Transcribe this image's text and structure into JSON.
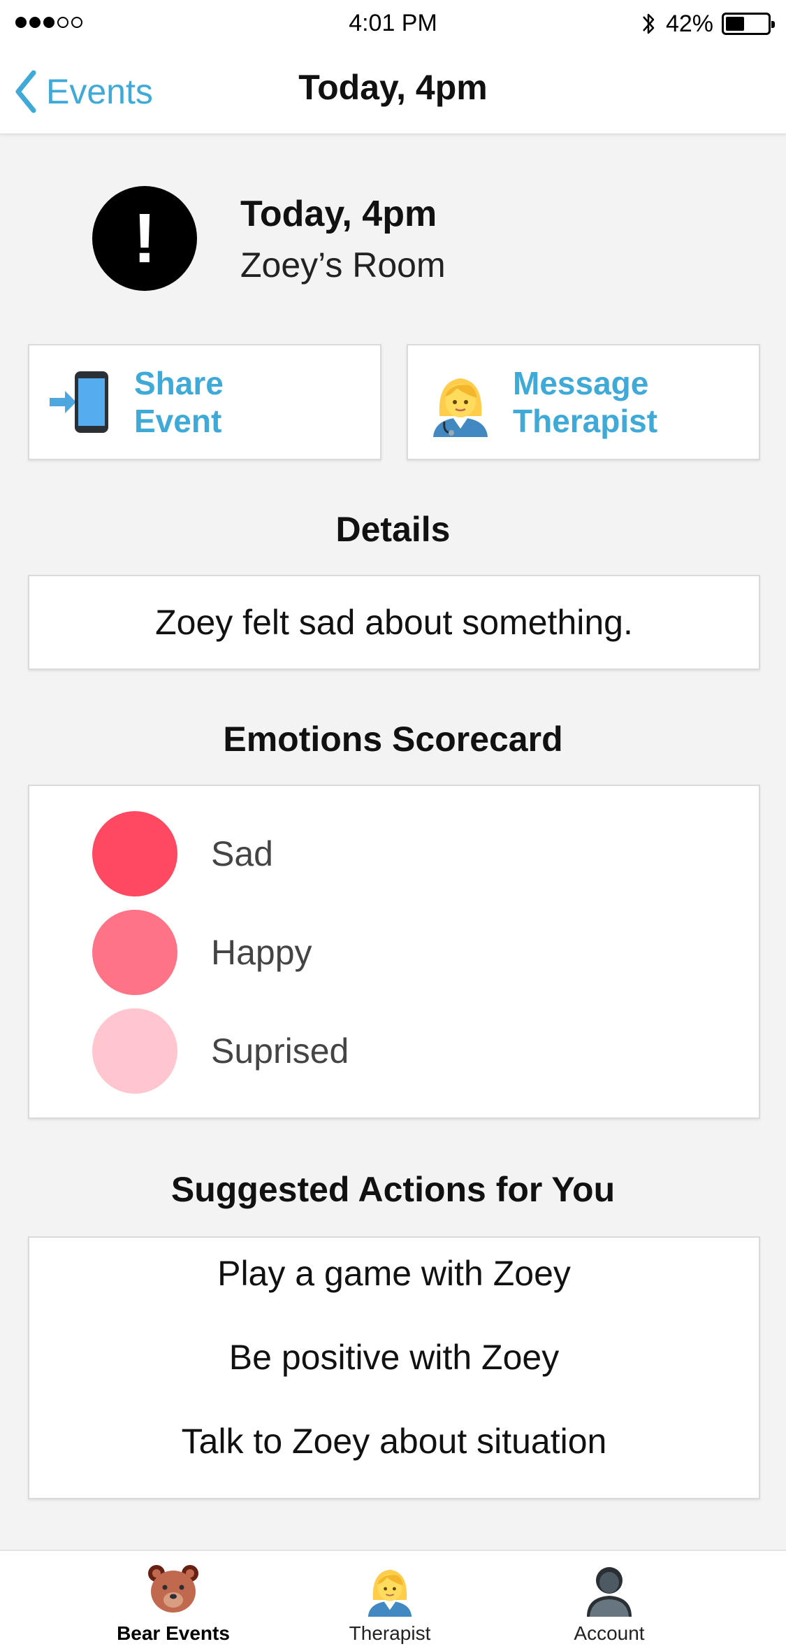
{
  "status_bar": {
    "time": "4:01 PM",
    "battery_percent": "42%",
    "signal_bars_filled": 3,
    "signal_bars_total": 5
  },
  "nav": {
    "back_label": "Events",
    "title": "Today, 4pm"
  },
  "event": {
    "alert_symbol": "!",
    "time": "Today, 4pm",
    "location": "Zoey’s Room"
  },
  "actions": {
    "share_line1": "Share",
    "share_line2": "Event",
    "share_icon": "phone-share-icon",
    "message_line1": "Message",
    "message_line2": "Therapist",
    "message_icon": "therapist-icon"
  },
  "details": {
    "heading": "Details",
    "text": "Zoey felt sad about something."
  },
  "emotions": {
    "heading": "Emotions Scorecard",
    "items": [
      {
        "label": "Sad",
        "color": "#ff4862"
      },
      {
        "label": "Happy",
        "color": "#ff7386"
      },
      {
        "label": "Suprised",
        "color": "#ffc6cf"
      }
    ]
  },
  "suggested": {
    "heading": "Suggested Actions for You",
    "items": [
      "Play a game with Zoey",
      "Be positive with Zoey",
      "Talk to Zoey about situation"
    ]
  },
  "tabs": [
    {
      "label": "Bear Events",
      "icon": "bear-icon",
      "active": true
    },
    {
      "label": "Therapist",
      "icon": "therapist-icon",
      "active": false
    },
    {
      "label": "Account",
      "icon": "account-icon",
      "active": false
    }
  ],
  "colors": {
    "accent": "#3fa9d8",
    "background": "#f3f3f3"
  }
}
